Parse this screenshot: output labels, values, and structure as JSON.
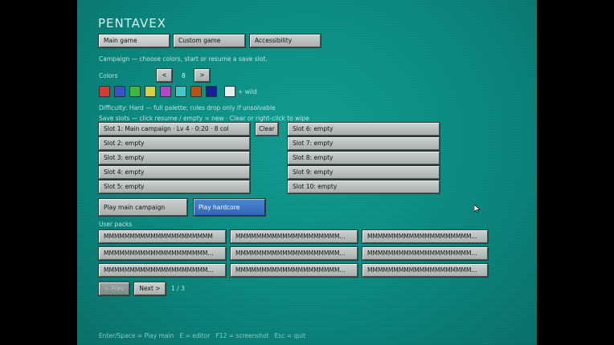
{
  "title": "PENTAVEX",
  "tabs": [
    "Main game",
    "Custom game",
    "Accessibility"
  ],
  "subtitle": "Campaign — choose colors, start or resume a save slot.",
  "colors": {
    "label": "Colors",
    "decrement_label": "<",
    "increment_label": ">",
    "count": "8",
    "swatches": [
      "#d63a33",
      "#3b52c9",
      "#3cb93a",
      "#d7cf45",
      "#b646c7",
      "#45c7c7",
      "#b85512",
      "#1a1d96"
    ],
    "wild_color": "#e8eeec",
    "wild_label": "+ wild"
  },
  "difficulty": "Difficulty: Hard — full palette; rules drop only if unsolvable",
  "save_hint": "Save slots — click resume / empty = new · Clear or right-click to wipe",
  "slots_left": [
    "Slot 1: Main campaign · Lv 4 · 0:20 · 8 col",
    "Slot 2: empty",
    "Slot 3: empty",
    "Slot 4: empty",
    "Slot 5: empty"
  ],
  "slots_right": [
    "Slot 6: empty",
    "Slot 7: empty",
    "Slot 8: empty",
    "Slot 9: empty",
    "Slot 10: empty"
  ],
  "clear_label": "Clear",
  "play_main_label": "Play main campaign",
  "play_hardcore_label": "Play hardcore",
  "user_packs": {
    "label": "User packs",
    "rows": [
      [
        "MMMMMMMMMMMMMMMMMMMMM",
        "MMMMMMMMMMMMMMMMMMMM...",
        "MMMMMMMMMMMMMMMMMMMM..."
      ],
      [
        "MMMMMMMMMMMMMMMMMMMM...",
        "MMMMMMMMMMMMMMMMMMMM...",
        "MMMMMMMMMMMMMMMMMMMM..."
      ],
      [
        "MMMMMMMMMMMMMMMMMMMM...",
        "MMMMMMMMMMMMMMMMMMMM...",
        "MMMMMMMMMMMMMMMMMMMM..."
      ]
    ]
  },
  "pagination": {
    "prev_label": "< Prev",
    "next_label": "Next >",
    "page": "1 / 3"
  },
  "footer": "Enter/Space = Play main   E = editor   F12 = screenshot   Esc = quit"
}
